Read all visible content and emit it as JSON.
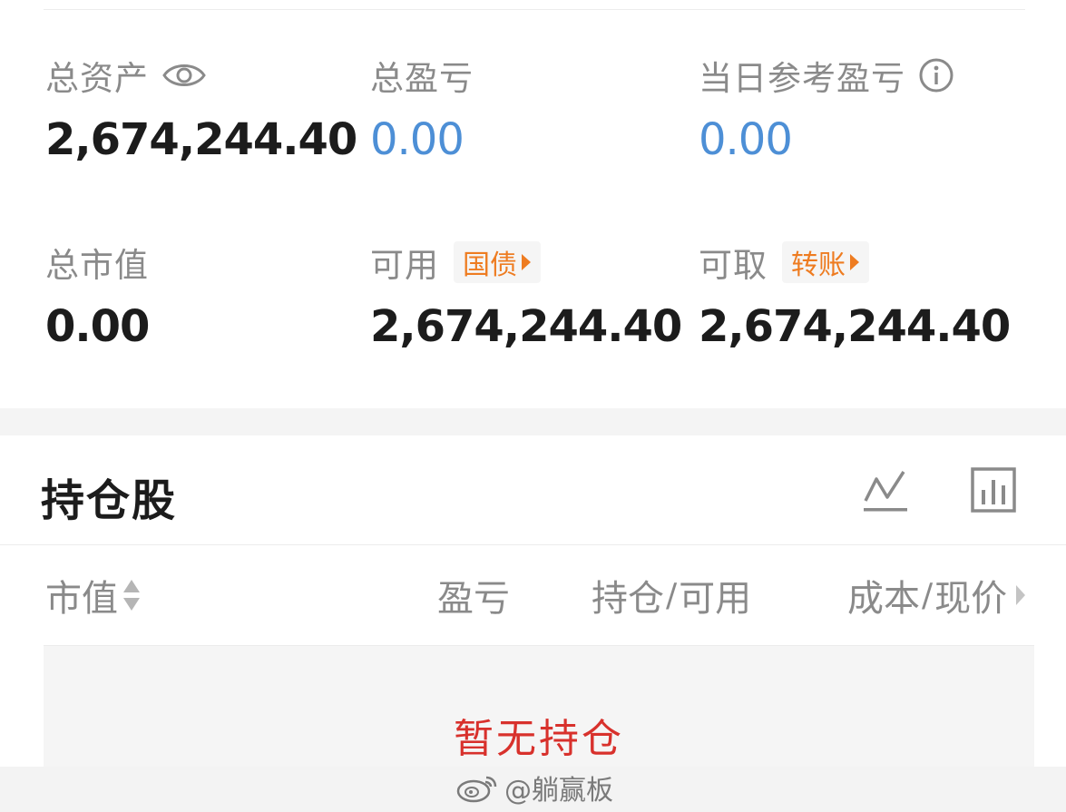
{
  "assets": {
    "total_assets": {
      "label": "总资产",
      "value": "2,674,244.40"
    },
    "total_pnl": {
      "label": "总盈亏",
      "value": "0.00"
    },
    "daily_pnl": {
      "label": "当日参考盈亏",
      "value": "0.00"
    },
    "market_value": {
      "label": "总市值",
      "value": "0.00"
    },
    "available": {
      "label": "可用",
      "tag": "国债",
      "value": "2,674,244.40"
    },
    "withdrawable": {
      "label": "可取",
      "tag": "转账",
      "value": "2,674,244.40"
    }
  },
  "holdings": {
    "title": "持仓股",
    "columns": {
      "market_value": "市值",
      "pnl": "盈亏",
      "position_a": "持仓",
      "position_b": "可用",
      "cost_a": "成本",
      "cost_b": "现价",
      "separator": "/"
    },
    "empty_text": "暂无持仓"
  },
  "watermark": {
    "text": "@躺赢板"
  },
  "colors": {
    "blue_value": "#4d8fd6",
    "tag_orange": "#ee7c21",
    "empty_red": "#d8312c",
    "label_gray": "#8a8a8a"
  },
  "icons": [
    "eye-icon",
    "info-icon",
    "trend-line-icon",
    "bar-chart-icon",
    "sort-icon",
    "chevron-right-icon",
    "weibo-logo-icon"
  ]
}
